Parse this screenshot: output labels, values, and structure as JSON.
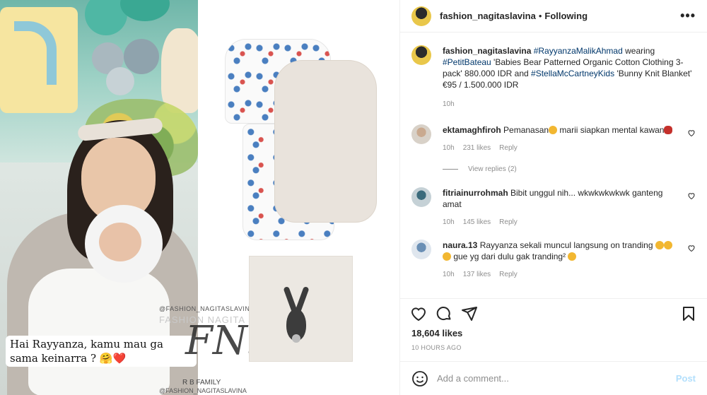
{
  "media": {
    "story_caption": "Hai Rayyanza, kamu mau ga sama keinarra ? 🤗❤️",
    "watermark_handle": "@FASHION_NAGITASLAVINA",
    "watermark_name": "FASHION NAGITA SLAVINA",
    "watermark_logo": "FNS",
    "watermark_family": "R B FAMILY",
    "watermark_handle_bottom": "@FASHION_NAGITASLAVINA"
  },
  "header": {
    "username": "fashion_nagitaslavina",
    "separator": "•",
    "follow_status": "Following",
    "more_label": "•••"
  },
  "post": {
    "username": "fashion_nagitaslavina",
    "tag1": "#RayyanzaMalikAhmad",
    "text1": " wearing ",
    "tag2": "#PetitBateau",
    "text2": " 'Babies Bear Patterned Organic Cotton Clothing 3-pack' 880.000 IDR and ",
    "tag3": "#StellaMcCartneyKids",
    "text3": " 'Bunny Knit Blanket' €95 / 1.500.000 IDR",
    "time": "10h"
  },
  "comments": [
    {
      "user": "ektamaghfiroh",
      "text": "Pemanasan",
      "text_b": " marii siapkan mental kawan",
      "time": "10h",
      "likes": "231 likes",
      "reply": "Reply"
    },
    {
      "user": "fitriainurrohmah",
      "text": "Bibit unggul nih... wkwkwkwkwk ganteng amat",
      "time": "10h",
      "likes": "145 likes",
      "reply": "Reply"
    },
    {
      "user": "naura.13",
      "text": "Rayyanza sekali muncul langsung on tranding",
      "text_b": " gue yg dari dulu gak tranding²",
      "time": "10h",
      "likes": "137 likes",
      "reply": "Reply"
    }
  ],
  "view_replies": "View replies (2)",
  "likes_count": "18,604 likes",
  "time_ago": "10 HOURS AGO",
  "add_comment": {
    "placeholder": "Add a comment...",
    "post_label": "Post"
  },
  "colors": {
    "link": "#00376b",
    "muted": "#8e8e8e",
    "post_disabled": "#b2dffc"
  }
}
